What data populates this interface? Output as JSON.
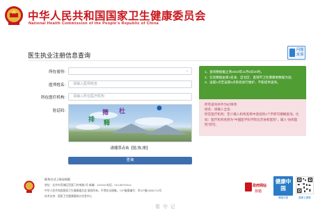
{
  "header": {
    "title": "中华人民共和国国家卫生健康委员会",
    "subtitle": "National Health Commission of the People's Republic of China"
  },
  "page": {
    "title": "医生执业注册信息查询",
    "feedback_line1": "问题",
    "feedback_line2": "反馈"
  },
  "form": {
    "province_label": "所在省份:",
    "province_value": "",
    "name_label": "医师姓名:",
    "name_placeholder": "请输入医师姓名",
    "institution_label": "所在医疗机构:",
    "institution_placeholder": "请输入所在医疗机构",
    "captcha_label": "验证码:",
    "captcha_chars": [
      "筛",
      "杜",
      "排",
      "释"
    ],
    "captcha_instruction": "请顺序点击【验,恢,排】",
    "query_button": "查询"
  },
  "notice": {
    "items": [
      "1、查询数据截止到2023年11月5日20时。",
      "2、信息数据由第1名省、自治区、直辖市卫生健康委数据为准;",
      "3、凌晨1点至凌晨5点系统进行维护，不能提供查询。"
    ]
  },
  "hint": {
    "heading": "所有查询条件为必填项:",
    "name_line": "姓名：请输入全名;",
    "institution_line": "所在医疗机构：至少输入机构名称中连续的4个字即可模糊查询。比如：医疗机构名称为\"中国医学科学院北京协和医院\"，输入\"协和医院\"即可。"
  },
  "footer": {
    "links": "联系方式 | 网站地图",
    "address": "地址：北京市西城区西直门外南路1号  邮编：100044  电话：010-68792114",
    "icp": "中华人民共和国国家卫生健康委员会  版权所有，不得非法镜像。  ICP备案编号：京ICP备18052714号",
    "support": "技术支持：国家卫生健康委统计信息中心",
    "gov_badge_line1": "政府网站",
    "gov_badge_line2": "找错",
    "health_badge": "健康中国",
    "health_sub": "健康中国",
    "qr_sub": "国家卫健委"
  },
  "watermark": "看 守 记",
  "colors": {
    "brand_red": "#c8161d",
    "primary_blue": "#3d6fb0",
    "notice_green": "#4f9d33",
    "hint_pink": "#f6e0e4"
  }
}
